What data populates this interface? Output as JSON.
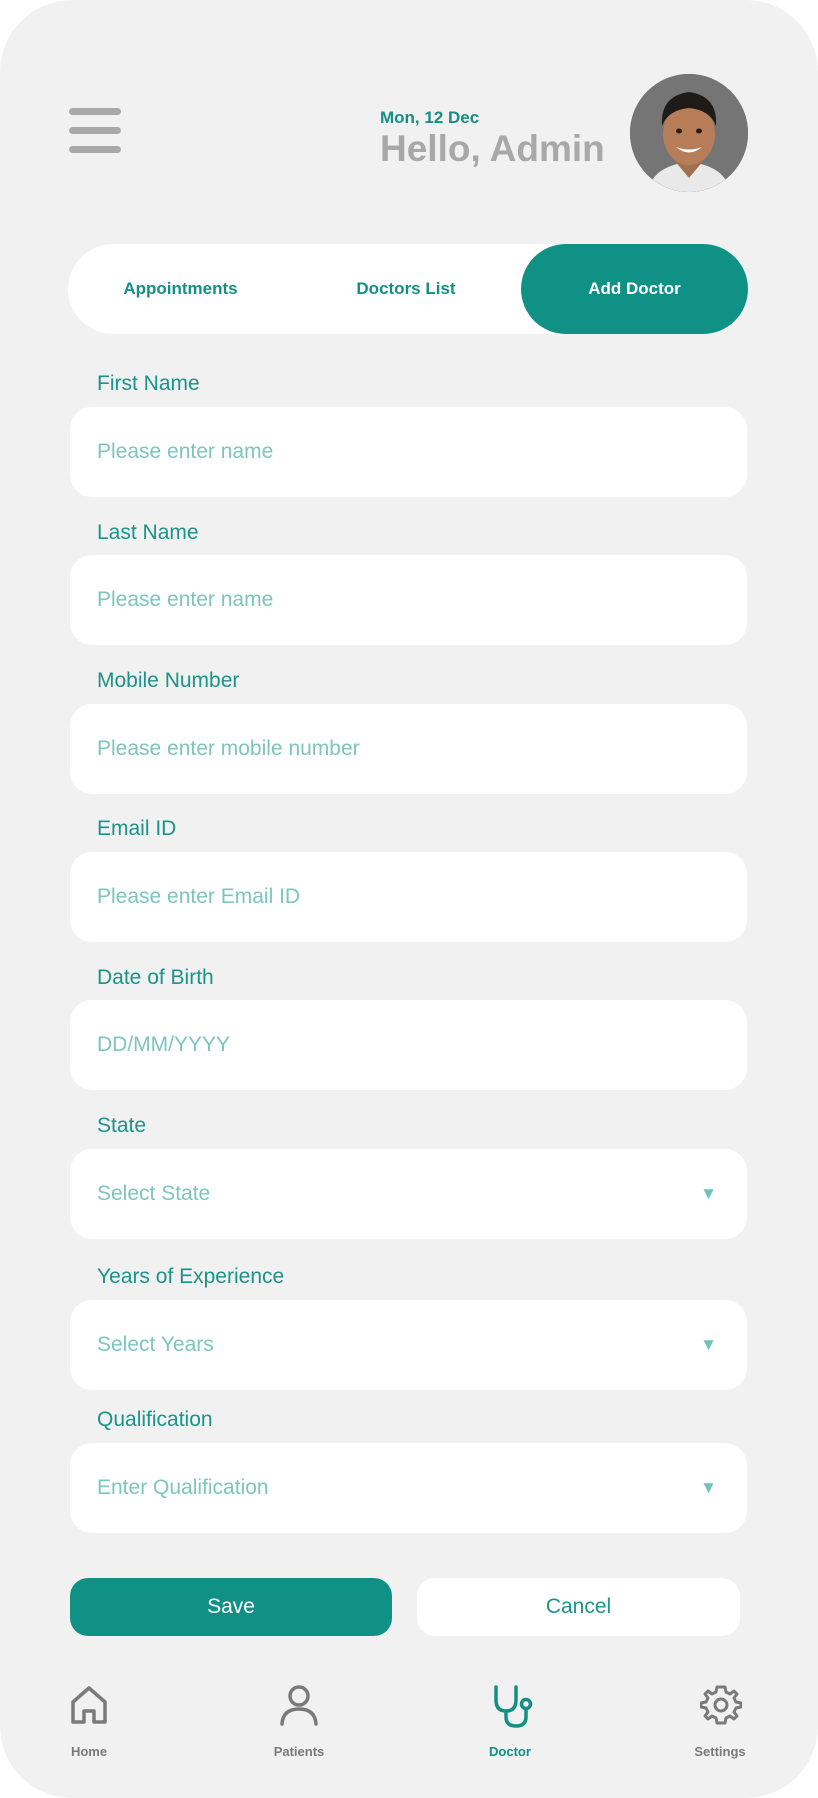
{
  "header": {
    "date": "Mon, 12 Dec",
    "greeting": "Hello, Admin"
  },
  "tabs": [
    {
      "label": "Appointments",
      "active": false
    },
    {
      "label": "Doctors List",
      "active": false
    },
    {
      "label": "Add Doctor",
      "active": true
    }
  ],
  "form": {
    "first_name": {
      "label": "First Name",
      "placeholder": "Please enter name"
    },
    "last_name": {
      "label": "Last Name",
      "placeholder": "Please enter name"
    },
    "mobile": {
      "label": "Mobile Number",
      "placeholder": "Please enter mobile number"
    },
    "email": {
      "label": "Email ID",
      "placeholder": "Please enter Email ID"
    },
    "dob": {
      "label": "Date of Birth",
      "placeholder": "DD/MM/YYYY"
    },
    "state": {
      "label": "State",
      "placeholder": "Select State"
    },
    "experience": {
      "label": "Years of Experience",
      "placeholder": "Select Years"
    },
    "qualification": {
      "label": "Qualification",
      "placeholder": "Enter Qualification"
    }
  },
  "actions": {
    "save_label": "Save",
    "cancel_label": "Cancel"
  },
  "bottom_nav": [
    {
      "label": "Home",
      "icon": "home-icon",
      "active": false
    },
    {
      "label": "Patients",
      "icon": "user-icon",
      "active": false
    },
    {
      "label": "Doctor",
      "icon": "stethoscope-icon",
      "active": true
    },
    {
      "label": "Settings",
      "icon": "gear-icon",
      "active": false
    }
  ],
  "colors": {
    "accent": "#0f9185",
    "background": "#f1f1f1",
    "placeholder": "#7dc5bf",
    "muted": "#a8a8a8"
  }
}
